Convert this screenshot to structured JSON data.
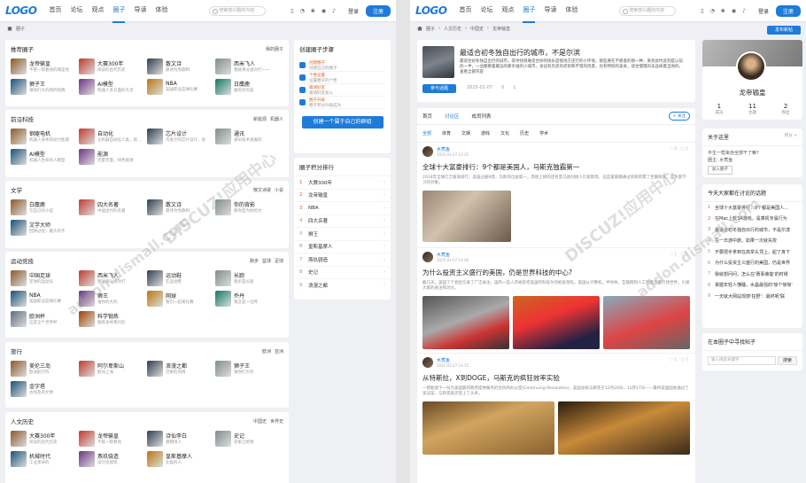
{
  "left": {
    "logo": "LOGO",
    "nav": [
      "首页",
      "论坛",
      "观点",
      "圈子",
      "导读",
      "体验"
    ],
    "nav_active": 3,
    "search_placeholder": "搜索感兴趣的内容",
    "login": "登录",
    "register": "注册",
    "breadcrumb": "圈子",
    "recommend": {
      "title": "推荐圈子",
      "more": "我的圈子",
      "items": [
        {
          "t": "龙帝输皇",
          "d": "不管一帮看他的偶是他"
        },
        {
          "t": "大赛300年",
          "d": "闲谈的古代历史"
        },
        {
          "t": "散文诗",
          "d": "愿诗为你歌和"
        },
        {
          "t": "西米飞人",
          "d": "我就将分进对打一一"
        },
        {
          "t": "狮子王",
          "d": "谁你们大的想的经典"
        },
        {
          "t": "AI模型",
          "d": "机器人多方面的大活"
        },
        {
          "t": "NBA",
          "d": "美国职业篮球比赛"
        },
        {
          "t": "日麋鹿",
          "d": "鹿的对对美"
        }
      ]
    },
    "tech": {
      "title": "前沿科技",
      "tags": [
        "新能源",
        "机器人"
      ],
      "items": [
        {
          "t": "钢躯电机",
          "d": "机器人身体的动力能源"
        },
        {
          "t": "自动化",
          "d": "让机器自动化人类，给..."
        },
        {
          "t": "芯片设计",
          "d": "为发计的芯片设计，会"
        },
        {
          "t": "通讯",
          "d": "通讯技术发展的"
        },
        {
          "t": "AI模型",
          "d": "机器人生命的人模型"
        },
        {
          "t": "能源",
          "d": "无量无量，绿色能源"
        }
      ]
    },
    "lit": {
      "title": "文学",
      "tags": [
        "散文诗歌",
        "小说"
      ],
      "items": [
        {
          "t": "白麋鹿",
          "d": "写自己的小说"
        },
        {
          "t": "四大名著",
          "d": "中国古代的名著"
        },
        {
          "t": "散文诗",
          "d": "愿诗为你歌和"
        },
        {
          "t": "你的背影",
          "d": "那你是为你的文"
        },
        {
          "t": "文学大师",
          "d": "回顾过往，最大的不"
        }
      ]
    },
    "sports": {
      "title": "运动竞技",
      "tags": [
        "跑步",
        "篮球",
        "足球"
      ],
      "items": [
        {
          "t": "中国足球",
          "d": "足球的运动员"
        },
        {
          "t": "西米飞人",
          "d": "我就将分进对打"
        },
        {
          "t": "运动鞋",
          "d": "在运动鞋"
        },
        {
          "t": "长跑",
          "d": "跑步是长跑"
        },
        {
          "t": "NBA",
          "d": "美国职业篮球比赛"
        },
        {
          "t": "狮王",
          "d": "谁你的大的"
        },
        {
          "t": "网球",
          "d": "我们一起来比赛"
        },
        {
          "t": "乔丹",
          "d": "我又是一位传"
        },
        {
          "t": "欧洲杯",
          "d": "这是全个世界杯"
        },
        {
          "t": "科学锻炼",
          "d": "锻炼身体我们的"
        }
      ]
    },
    "travel": {
      "title": "旅行",
      "tags": [
        "欧洲",
        "亚洲"
      ],
      "items": [
        {
          "t": "美伦三岛",
          "d": "欧洲航行的"
        },
        {
          "t": "阿尔卑斯山",
          "d": "欧洲上海"
        },
        {
          "t": "浪漫之都",
          "d": "巴黎的风情"
        },
        {
          "t": "狮子王",
          "d": "谁你们大的"
        },
        {
          "t": "金字塔",
          "d": "古埃及的文明"
        }
      ]
    },
    "culture": {
      "title": "人文历史",
      "tags": [
        "中国史",
        "世界史"
      ],
      "items": [
        {
          "t": "大赛300年",
          "d": "闲谈的古代历史"
        },
        {
          "t": "龙帝输皇",
          "d": "不管一帮看他"
        },
        {
          "t": "诗仙李白",
          "d": "唐朝诗人"
        },
        {
          "t": "史记",
          "d": "史家之绝唱"
        },
        {
          "t": "机械时代",
          "d": "工业革命的"
        },
        {
          "t": "燕玖骁造",
          "d": "设计古建筑"
        },
        {
          "t": "皇斯基摩人",
          "d": "北极的人"
        }
      ]
    },
    "create": {
      "title": "创建圈子步骤",
      "steps": [
        {
          "a": "创建圈子",
          "b": "创建自己的圈子"
        },
        {
          "a": "个性设置",
          "b": "设置圈子的个性"
        },
        {
          "a": "邀请好友",
          "b": "邀请好友加入"
        },
        {
          "a": "圈子升级",
          "b": "圈子积分升级成为"
        }
      ],
      "button": "创建一个属于自己的群组"
    },
    "rank": {
      "title": "圈子积分排行",
      "items": [
        {
          "n": "1",
          "t": "大赛300年"
        },
        {
          "n": "2",
          "t": "龙帝输皇"
        },
        {
          "n": "3",
          "t": "NBA"
        },
        {
          "n": "4",
          "t": "四大名著"
        },
        {
          "n": "5",
          "t": "狮王"
        },
        {
          "n": "6",
          "t": "皇斯基摩人"
        },
        {
          "n": "7",
          "t": "燕玖骁造"
        },
        {
          "n": "8",
          "t": "史记"
        },
        {
          "n": "9",
          "t": "浪漫之都"
        }
      ]
    }
  },
  "right": {
    "breadcrumb": [
      "圈子",
      "人文历史",
      "中国史",
      "龙帝输皇"
    ],
    "publish": "发布新帖",
    "group": {
      "title": "最适合初冬独自出行的城市，不是尔滨",
      "text": "最适合初冬独自出行的城市，得寻找很难适合你的快乐度假地方还行的小环境，那些要在不愿意的那一种，来到此时此刻是以前的一半，一边都看着最远的那幸福的小城市，身边有历史的老街和不错的风景，也有特别的美食，适合慢慢的去品味着当地的。  查看全部内容",
      "join": "参与话题",
      "date": "2025-01-07",
      "comments": "0",
      "likes": "1"
    },
    "tabs": [
      "首页",
      "讨论区",
      "成员列表"
    ],
    "tab_active": 1,
    "follow": "+ 关注",
    "subtabs": [
      "全部",
      "体育",
      "文娱",
      "游戏",
      "文化",
      "历史",
      "学术"
    ],
    "posts": [
      {
        "user": "水煮鱼",
        "date": "2025-01-07 15:25",
        "title": "全球十大富豪排行：9个都是美国人，马斯克独霸第一",
        "excerpt": "2024年全球亿万富翁排行，美国占据9席，马斯克位居第一，其他上榜的还有亚马逊创始人贝索斯等，这些富豪都通过创新积累了巨额财富，是大家学习的对象。"
      },
      {
        "user": "水煮鱼",
        "date": "2025-01-07 14:56",
        "title": "为什么投资主义盛行的美国，仍是世界科技的中心?",
        "excerpt": "截几天，美国了个调出引发了广泛关注，国内一些人开始思考美国的科技为何如此领先，美国从计算机，半导体，互联网到人工智能全面引领世界，引发大家的关注和讨论。"
      },
      {
        "user": "水煮鱼",
        "date": "2025-01-07 14:15",
        "title": "从特斯拉，X到DOGE，马斯克的疯狂效率实验",
        "excerpt": "一把能放下一份为美国联邦政府提供服务的合同的办公室(Continuing Resolution)，美国总统马斯克于12月20日，12月17日——最终美国国会通过了该法案，马斯克再次登上了头条。"
      }
    ],
    "profile": {
      "name": "龙帝输皇",
      "stats": [
        {
          "v": "1",
          "l": "成员"
        },
        {
          "v": "11",
          "l": "主题"
        },
        {
          "v": "2",
          "l": "粉丝"
        }
      ]
    },
    "about": {
      "title": "关于这里",
      "right": "积分 >",
      "lines": [
        "平生一帮来自全部干了嘛?",
        "圈主: 水煮鱼"
      ],
      "join": "加入圈子"
    },
    "hot": {
      "title": "今天大家都在讨论的话题",
      "items": [
        "全球十大富豪排行：9个都是美国人...",
        "在Mac上玩3A游戏，是乘机专属行为",
        "最适合初冬独自出行的城市，不是尔滨",
        "在一日游中旅，如果一次就失败",
        "不要把手拿到在高举头顶上，起了身下",
        "为什么投资主义盛行的美国，仍是世界",
        "我就想问问，怎么在'赛事谁能'的时候",
        "掌握年轻人懂睡，水晶最强的'惊个惊惊'",
        "一天就大网站现感'狂野'：最终呢'联"
      ]
    },
    "search": {
      "title": "在本圈子中寻找帖子",
      "placeholder": "输入搜索关键字",
      "button": "搜索"
    }
  },
  "colors": {
    "accent": "#1e7bd9",
    "rank": "#e0651f"
  }
}
